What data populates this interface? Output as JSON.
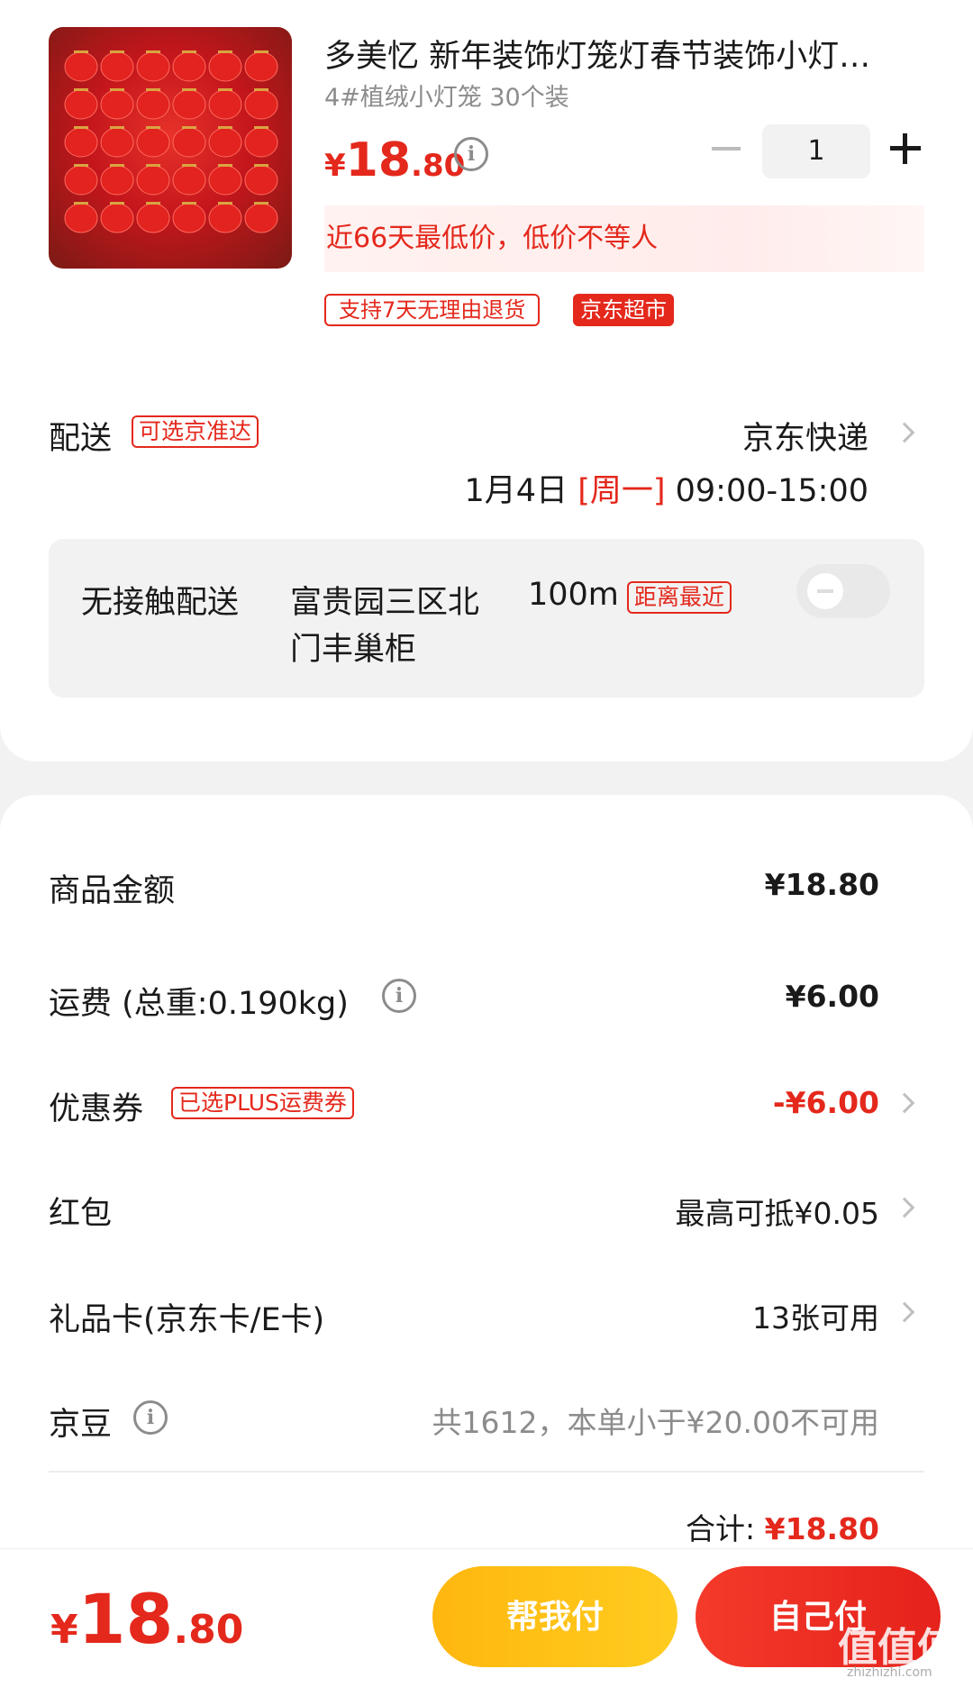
{
  "product": {
    "title": "多美忆 新年装饰灯笼灯春节装饰小灯…",
    "spec": "4#植绒小灯笼 30个装",
    "price_currency": "¥",
    "price_int": "18",
    "price_dec": ".80",
    "quantity": "1",
    "lowprice_note": "近66天最低价，低价不等人",
    "tag_return": "支持7天无理由退货",
    "tag_store": "京东超市",
    "info_icon_glyph": "i"
  },
  "delivery": {
    "label": "配送",
    "badge": "可选京准达",
    "carrier": "京东快递",
    "date": "1月4日",
    "weekday": "[周一]",
    "time": "09:00-15:00",
    "pickup_label": "无接触配送",
    "pickup_location_line1": "富贵园三区北",
    "pickup_location_line2": "门丰巢柜",
    "pickup_distance": "100m",
    "pickup_badge": "距离最近"
  },
  "summary": {
    "goods_label": "商品金额",
    "goods_value": "¥18.80",
    "freight_label": "运费 (总重:0.190kg)",
    "freight_value": "¥6.00",
    "coupon_label": "优惠券",
    "coupon_badge": "已选PLUS运费券",
    "coupon_value": "-¥6.00",
    "redpacket_label": "红包",
    "redpacket_value": "最高可抵¥0.05",
    "giftcard_label": "礼品卡(京东卡/E卡)",
    "giftcard_value": "13张可用",
    "beans_label": "京豆",
    "beans_value": "共1612，本单小于¥20.00不可用",
    "total_label": "合计:",
    "total_value": "¥18.80"
  },
  "bottom": {
    "price_currency": "¥",
    "price_int": "18",
    "price_dec": ".80",
    "help_pay": "帮我付",
    "self_pay": "自己付",
    "watermark": "值值值",
    "watermark_url": "zhizhizhi.com"
  },
  "colors": {
    "accent_red": "#e4281c",
    "help_button_yellow": "#ffb70f",
    "background_gray": "#f2f2f2"
  }
}
